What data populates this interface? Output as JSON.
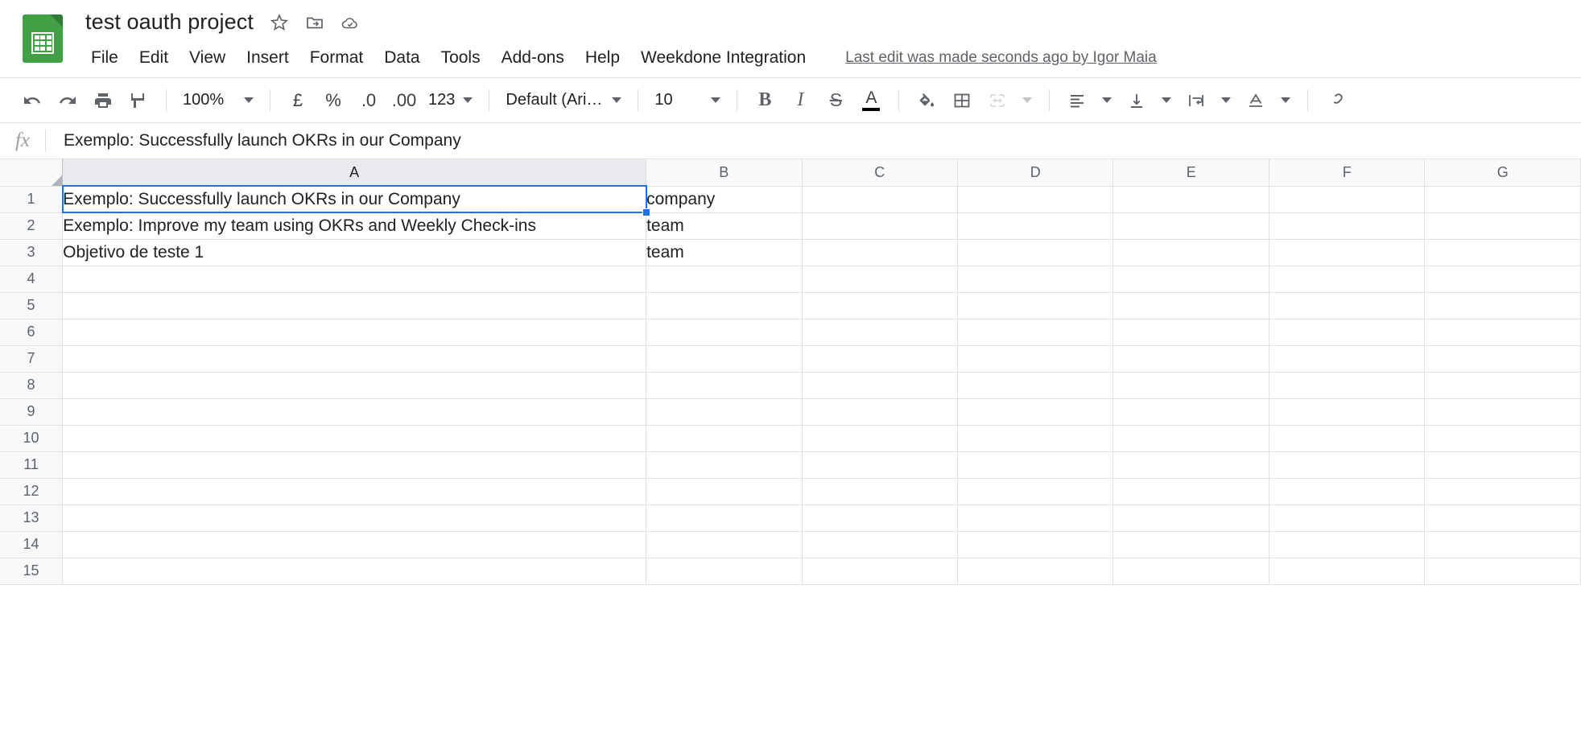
{
  "header": {
    "doc_title": "test oauth project",
    "icons": [
      {
        "name": "star-icon",
        "title": "Star"
      },
      {
        "name": "move-to-folder-icon",
        "title": "Move to folder"
      },
      {
        "name": "cloud-saved-icon",
        "title": "Saved to Drive"
      }
    ],
    "menus": [
      "File",
      "Edit",
      "View",
      "Insert",
      "Format",
      "Data",
      "Tools",
      "Add-ons",
      "Help",
      "Weekdone Integration"
    ],
    "last_edit": "Last edit was made seconds ago by Igor Maia"
  },
  "toolbar": {
    "undo_icon": "undo-icon",
    "redo_icon": "redo-icon",
    "print_icon": "print-icon",
    "paint_format_icon": "paint-format-icon",
    "zoom_value": "100%",
    "currency_label": "£",
    "percent_label": "%",
    "decrease_decimal_label": ".0",
    "increase_decimal_label": ".00",
    "more_formats_label": "123",
    "font_value": "Default (Ari…",
    "font_size_value": "10",
    "bold_label": "B",
    "italic_label": "I",
    "strikethrough_label": "S",
    "text_color_label": "A",
    "text_color_swatch": "#000000",
    "fill_color_icon": "fill-color-icon",
    "borders_icon": "borders-icon",
    "merge_cells_icon": "merge-cells-icon",
    "halign_icon": "horizontal-align-icon",
    "valign_icon": "vertical-align-icon",
    "text_wrap_icon": "text-wrapping-icon",
    "text_rotation_icon": "text-rotation-icon",
    "link_icon": "insert-link-icon"
  },
  "formula_bar": {
    "fx_label": "fx",
    "value": "Exemplo: Successfully launch OKRs in our Company"
  },
  "sheet": {
    "columns": [
      "A",
      "B",
      "C",
      "D",
      "E",
      "F",
      "G"
    ],
    "selected_column": "A",
    "selected_cell": "A1",
    "rows": [
      {
        "num": "1",
        "A": "Exemplo: Successfully launch OKRs in our Company",
        "B": "company"
      },
      {
        "num": "2",
        "A": "Exemplo: Improve my team using OKRs and Weekly Check-ins",
        "B": "team"
      },
      {
        "num": "3",
        "A": "Objetivo de teste 1",
        "B": "team"
      },
      {
        "num": "4",
        "A": "",
        "B": ""
      },
      {
        "num": "5",
        "A": "",
        "B": ""
      },
      {
        "num": "6",
        "A": "",
        "B": ""
      },
      {
        "num": "7",
        "A": "",
        "B": ""
      },
      {
        "num": "8",
        "A": "",
        "B": ""
      },
      {
        "num": "9",
        "A": "",
        "B": ""
      },
      {
        "num": "10",
        "A": "",
        "B": ""
      },
      {
        "num": "11",
        "A": "",
        "B": ""
      },
      {
        "num": "12",
        "A": "",
        "B": ""
      },
      {
        "num": "13",
        "A": "",
        "B": ""
      },
      {
        "num": "14",
        "A": "",
        "B": ""
      },
      {
        "num": "15",
        "A": "",
        "B": ""
      }
    ]
  },
  "colors": {
    "accent": "#1a73e8",
    "brand_green": "#43a047",
    "header_bg": "#f8f9fa",
    "selected_header_bg": "#e8eaed",
    "grid_line": "#e0e0e0",
    "text": "#202124",
    "muted_text": "#5f6368"
  }
}
